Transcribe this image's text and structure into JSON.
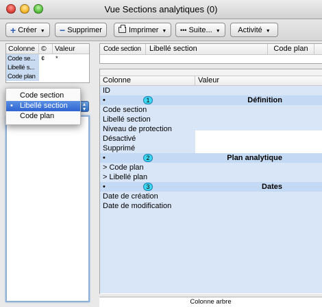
{
  "window": {
    "title": "Vue Sections analytiques  (0)"
  },
  "toolbar": {
    "create": "Créer",
    "delete": "Supprimer",
    "print": "Imprimer",
    "more": "Suite...",
    "activity": "Activité"
  },
  "left_table": {
    "headers": [
      "Colonne",
      "©",
      "Valeur"
    ],
    "rows": [
      {
        "col": "Code se...",
        "op": "¢",
        "val": "*"
      },
      {
        "col": "Libellé s...",
        "op": "",
        "val": ""
      },
      {
        "col": "Code plan",
        "op": "",
        "val": ""
      }
    ]
  },
  "sort_menu": {
    "items": [
      "Code section",
      "Libellé section",
      "Code plan"
    ],
    "selected_index": 1,
    "selected_marker": "•"
  },
  "top_right_table": {
    "headers": [
      "Code section",
      "Libellé section",
      "Code plan"
    ]
  },
  "main_table": {
    "headers": [
      "Colonne",
      "Valeur"
    ],
    "rows": [
      {
        "type": "field",
        "label": "ID"
      },
      {
        "type": "group",
        "bullet": "•",
        "num": "1",
        "label": "Définition"
      },
      {
        "type": "field",
        "label": "Code section"
      },
      {
        "type": "field",
        "label": "Libellé section"
      },
      {
        "type": "field",
        "label": "Niveau de protection"
      },
      {
        "type": "field",
        "label": "Désactivé"
      },
      {
        "type": "field",
        "label": "Supprimé"
      },
      {
        "type": "group",
        "bullet": "•",
        "num": "2",
        "label": "Plan analytique"
      },
      {
        "type": "field",
        "label": "> Code plan"
      },
      {
        "type": "field",
        "label": "> Libellé plan"
      },
      {
        "type": "group",
        "bullet": "•",
        "num": "3",
        "label": "Dates"
      },
      {
        "type": "field",
        "label": "Date de création"
      },
      {
        "type": "field",
        "label": "Date de modification"
      }
    ]
  },
  "footer": {
    "label": "Colonne arbre"
  }
}
